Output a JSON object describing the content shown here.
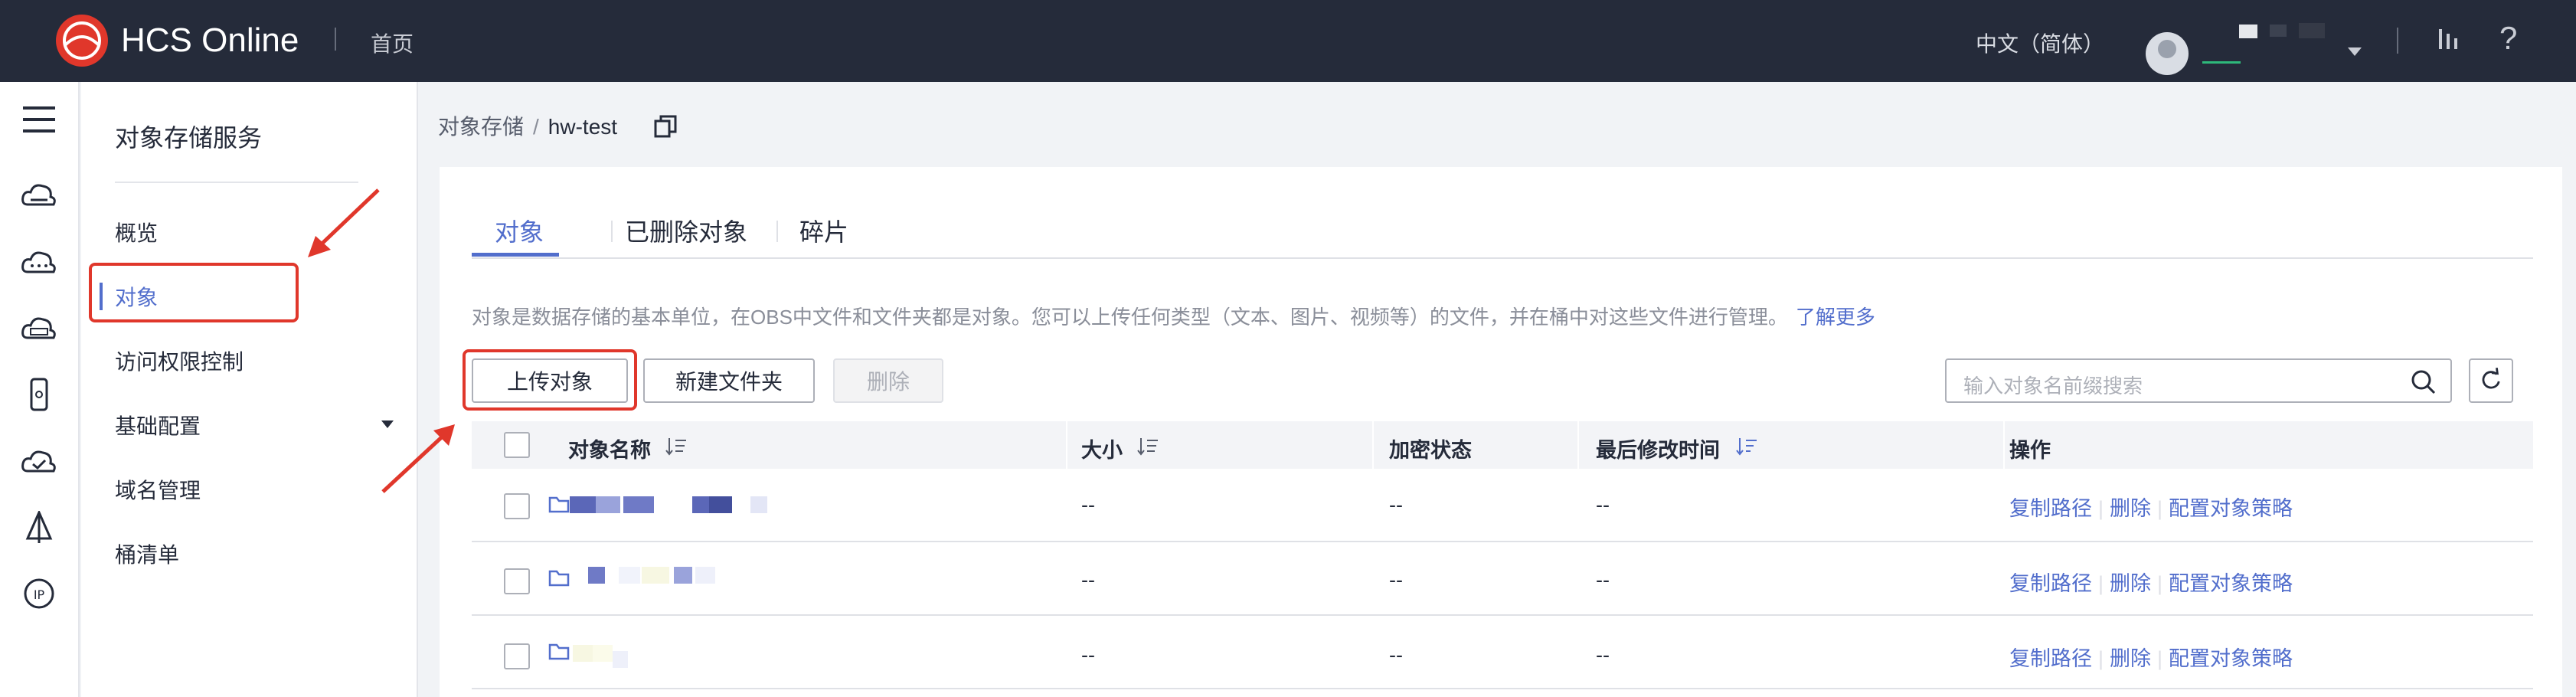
{
  "header": {
    "brand": "HCS Online",
    "home": "首页",
    "language": "中文（简体）"
  },
  "sidebar": {
    "title": "对象存储服务",
    "items": [
      {
        "label": "概览"
      },
      {
        "label": "对象"
      },
      {
        "label": "访问权限控制"
      },
      {
        "label": "基础配置"
      },
      {
        "label": "域名管理"
      },
      {
        "label": "桶清单"
      }
    ]
  },
  "breadcrumb": {
    "root": "对象存储",
    "separator": "/",
    "current": "hw-test"
  },
  "tabs": [
    {
      "label": "对象"
    },
    {
      "label": "已删除对象"
    },
    {
      "label": "碎片"
    }
  ],
  "description": {
    "text": "对象是数据存储的基本单位，在OBS中文件和文件夹都是对象。您可以上传任何类型（文本、图片、视频等）的文件，并在桶中对这些文件进行管理。",
    "link": "了解更多"
  },
  "toolbar": {
    "upload": "上传对象",
    "new_folder": "新建文件夹",
    "delete": "删除",
    "search_placeholder": "输入对象名前缀搜索"
  },
  "table": {
    "columns": [
      "对象名称",
      "大小",
      "加密状态",
      "最后修改时间",
      "操作"
    ],
    "rows": [
      {
        "size": "--",
        "encryption": "--",
        "modified": "--"
      },
      {
        "size": "--",
        "encryption": "--",
        "modified": "--"
      },
      {
        "size": "--",
        "encryption": "--",
        "modified": "--"
      }
    ],
    "actions": [
      "复制路径",
      "删除",
      "配置对象策略"
    ]
  },
  "colors": {
    "topbar": "#252b3a",
    "accent": "#526ecc",
    "annotation": "#e0372b"
  }
}
